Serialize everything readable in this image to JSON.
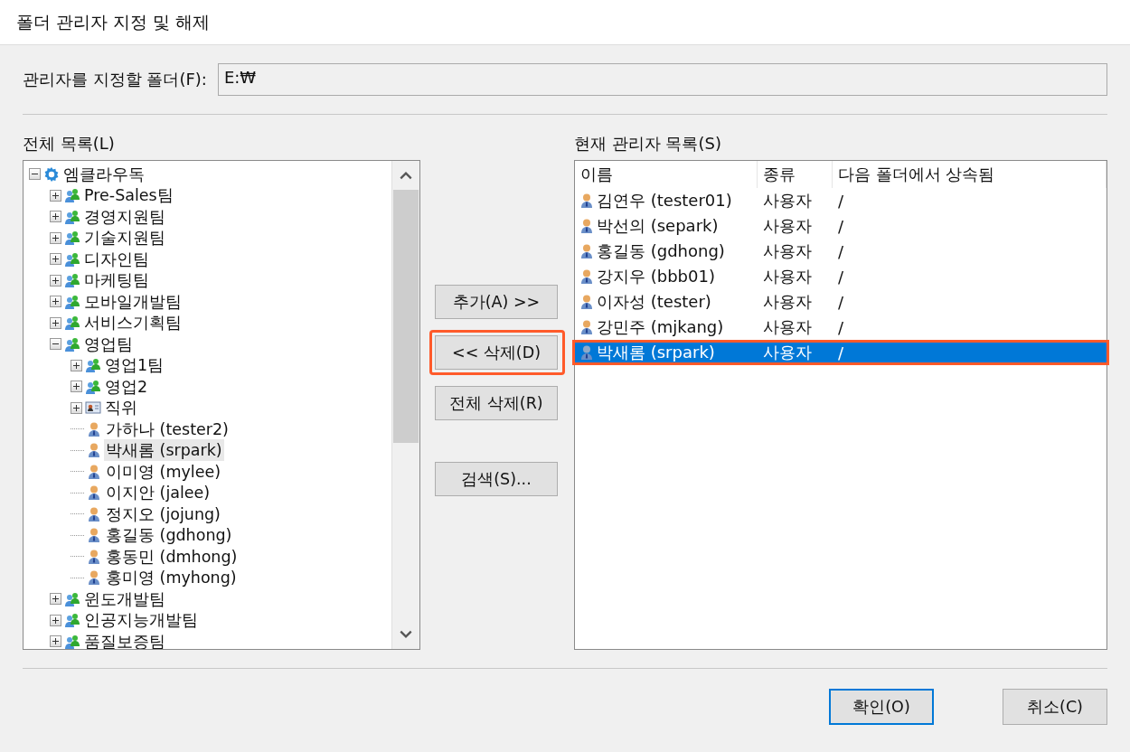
{
  "window": {
    "title": "폴더 관리자 지정 및 해제"
  },
  "folder": {
    "label": "관리자를 지정할 폴더(F):",
    "value": "E:₩"
  },
  "tree": {
    "label": "전체 목록(L)",
    "items": [
      {
        "kind": "org",
        "label": "엠클라우독",
        "expanded": true,
        "selected": false,
        "children": [
          {
            "kind": "group",
            "label": "Pre-Sales팀",
            "expanded": false,
            "selected": false
          },
          {
            "kind": "group",
            "label": "경영지원팀",
            "expanded": false,
            "selected": false
          },
          {
            "kind": "group",
            "label": "기술지원팀",
            "expanded": false,
            "selected": false
          },
          {
            "kind": "group",
            "label": "디자인팀",
            "expanded": false,
            "selected": false
          },
          {
            "kind": "group",
            "label": "마케팅팀",
            "expanded": false,
            "selected": false
          },
          {
            "kind": "group",
            "label": "모바일개발팀",
            "expanded": false,
            "selected": false
          },
          {
            "kind": "group",
            "label": "서비스기획팀",
            "expanded": false,
            "selected": false
          },
          {
            "kind": "group",
            "label": "영업팀",
            "expanded": true,
            "selected": false,
            "children": [
              {
                "kind": "group",
                "label": "영업1팀",
                "expanded": false,
                "selected": false
              },
              {
                "kind": "group",
                "label": "영업2",
                "expanded": false,
                "selected": false
              },
              {
                "kind": "position",
                "label": "직위",
                "expanded": false,
                "selected": false
              },
              {
                "kind": "user",
                "label": "가하나 (tester2)",
                "selected": false
              },
              {
                "kind": "user",
                "label": "박새롬 (srpark)",
                "selected": true
              },
              {
                "kind": "user",
                "label": "이미영 (mylee)",
                "selected": false
              },
              {
                "kind": "user",
                "label": "이지안 (jalee)",
                "selected": false
              },
              {
                "kind": "user",
                "label": "정지오 (jojung)",
                "selected": false
              },
              {
                "kind": "user",
                "label": "홍길동 (gdhong)",
                "selected": false
              },
              {
                "kind": "user",
                "label": "홍동민 (dmhong)",
                "selected": false
              },
              {
                "kind": "user",
                "label": "홍미영 (myhong)",
                "selected": false
              }
            ]
          },
          {
            "kind": "group",
            "label": "윈도개발팀",
            "expanded": false,
            "selected": false
          },
          {
            "kind": "group",
            "label": "인공지능개발팀",
            "expanded": false,
            "selected": false
          },
          {
            "kind": "group",
            "label": "품질보증팀",
            "expanded": false,
            "selected": false
          }
        ]
      }
    ]
  },
  "actions": [
    {
      "label": "추가(A) >>",
      "highlighted": false
    },
    {
      "label": "<< 삭제(D)",
      "highlighted": true
    },
    {
      "label": "전체 삭제(R)",
      "highlighted": false
    },
    {
      "label": "검색(S)...",
      "highlighted": false
    }
  ],
  "admins": {
    "label": "현재 관리자 목록(S)",
    "columns": [
      "이름",
      "종류",
      "다음 폴더에서 상속됨"
    ],
    "rows": [
      {
        "name": "김연우 (tester01)",
        "type": "사용자",
        "inherited": "/",
        "selected": false,
        "highlighted": false
      },
      {
        "name": "박선의 (separk)",
        "type": "사용자",
        "inherited": "/",
        "selected": false,
        "highlighted": false
      },
      {
        "name": "홍길동 (gdhong)",
        "type": "사용자",
        "inherited": "/",
        "selected": false,
        "highlighted": false
      },
      {
        "name": "강지우 (bbb01)",
        "type": "사용자",
        "inherited": "/",
        "selected": false,
        "highlighted": false
      },
      {
        "name": "이자성 (tester)",
        "type": "사용자",
        "inherited": "/",
        "selected": false,
        "highlighted": false
      },
      {
        "name": "강민주 (mjkang)",
        "type": "사용자",
        "inherited": "/",
        "selected": false,
        "highlighted": false
      },
      {
        "name": "박새롬 (srpark)",
        "type": "사용자",
        "inherited": "/",
        "selected": true,
        "highlighted": true
      }
    ]
  },
  "buttons": [
    {
      "label": "확인(O)",
      "default": true
    },
    {
      "label": "취소(C)",
      "default": false
    }
  ]
}
